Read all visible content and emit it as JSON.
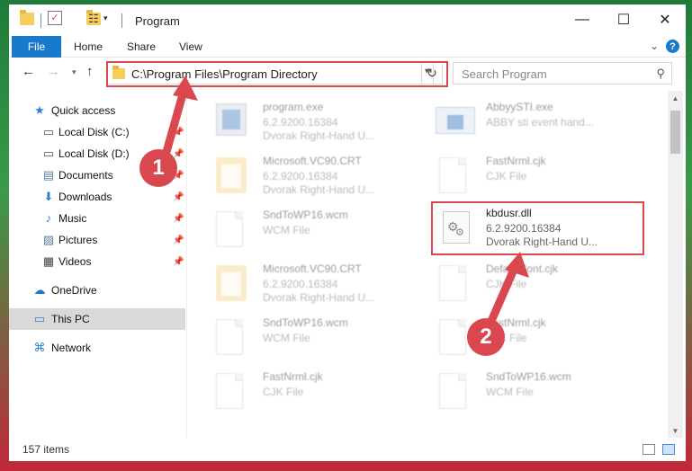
{
  "window": {
    "title": "Program",
    "controls": {
      "minimize": "—",
      "maximize": "☐",
      "close": "✕"
    }
  },
  "ribbon": {
    "tabs": [
      "File",
      "Home",
      "Share",
      "View"
    ],
    "expand_icon": "chevron-down-icon",
    "help_label": "?"
  },
  "nav": {
    "address": "C:\\Program Files\\Program Directory",
    "search_placeholder": "Search Program"
  },
  "sidebar": {
    "items": [
      {
        "label": "Quick access",
        "icon": "star-icon",
        "pinned": false
      },
      {
        "label": "Local Disk (C:)",
        "icon": "drive-icon",
        "pinned": true
      },
      {
        "label": "Local Disk (D:)",
        "icon": "drive-icon",
        "pinned": true
      },
      {
        "label": "Documents",
        "icon": "documents-icon",
        "pinned": true
      },
      {
        "label": "Downloads",
        "icon": "download-icon",
        "pinned": true
      },
      {
        "label": "Music",
        "icon": "music-icon",
        "pinned": true
      },
      {
        "label": "Pictures",
        "icon": "pictures-icon",
        "pinned": true
      },
      {
        "label": "Videos",
        "icon": "videos-icon",
        "pinned": true
      },
      {
        "label": "OneDrive",
        "icon": "cloud-icon",
        "pinned": false
      },
      {
        "label": "This PC",
        "icon": "computer-icon",
        "pinned": false,
        "selected": true
      },
      {
        "label": "Network",
        "icon": "network-icon",
        "pinned": false
      }
    ]
  },
  "files": [
    {
      "name": "program.exe",
      "line1": "6.2.9200.16384",
      "line2": "Dvorak Right-Hand U...",
      "kind": "exe"
    },
    {
      "name": "AbbyySTI.exe",
      "line1": "ABBY sti event hand...",
      "line2": "",
      "kind": "app"
    },
    {
      "name": "Microsoft.VC90.CRT",
      "line1": "6.2.9200.16384",
      "line2": "Dvorak Right-Hand U...",
      "kind": "folder"
    },
    {
      "name": "FastNrml.cjk",
      "line1": "CJK File",
      "line2": "",
      "kind": "doc"
    },
    {
      "name": "SndToWP16.wcm",
      "line1": "WCM File",
      "line2": "",
      "kind": "doc"
    },
    {
      "name": "kbdusr.dll",
      "line1": "6.2.9200.16384",
      "line2": "Dvorak Right-Hand U...",
      "kind": "dll"
    },
    {
      "name": "Microsoft.VC90.CRT",
      "line1": "6.2.9200.16384",
      "line2": "Dvorak Right-Hand U...",
      "kind": "folder"
    },
    {
      "name": "DefaultFont.cjk",
      "line1": "CJK File",
      "line2": "",
      "kind": "doc"
    },
    {
      "name": "SndToWP16.wcm",
      "line1": "WCM File",
      "line2": "",
      "kind": "doc"
    },
    {
      "name": "FastNrml.cjk",
      "line1": "CJK File",
      "line2": "",
      "kind": "doc"
    },
    {
      "name": "FastNrml.cjk",
      "line1": "CJK File",
      "line2": "",
      "kind": "doc"
    },
    {
      "name": "SndToWP16.wcm",
      "line1": "WCM File",
      "line2": "",
      "kind": "doc"
    }
  ],
  "status": {
    "items": "157 items"
  },
  "annotations": {
    "step1": "1",
    "step2": "2",
    "color": "#d9484f"
  }
}
